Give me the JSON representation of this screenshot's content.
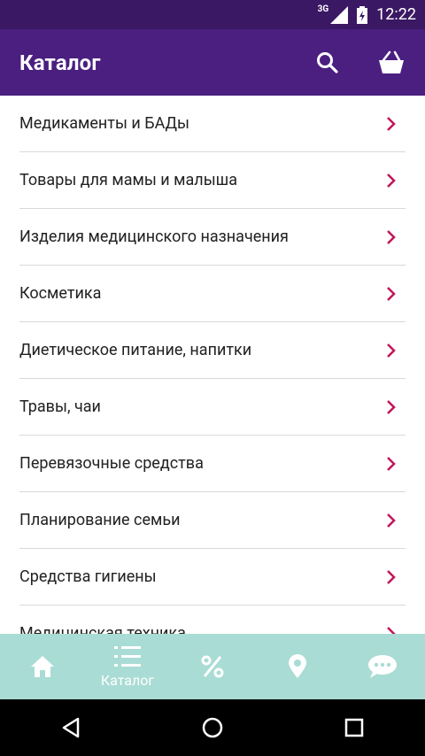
{
  "status_bar": {
    "network": "3G",
    "time": "12:22"
  },
  "app_bar": {
    "title": "Каталог",
    "search_icon": "search-icon",
    "cart_icon": "basket-icon"
  },
  "catalog": {
    "items": [
      {
        "label": "Медикаменты и БАДы"
      },
      {
        "label": "Товары для мамы и малыша"
      },
      {
        "label": "Изделия медицинского назначения"
      },
      {
        "label": "Косметика"
      },
      {
        "label": "Диетическое питание, напитки"
      },
      {
        "label": "Травы, чаи"
      },
      {
        "label": "Перевязочные средства"
      },
      {
        "label": "Планирование семьи"
      },
      {
        "label": "Средства гигиены"
      },
      {
        "label": "Медицинская техника"
      }
    ]
  },
  "bottom_nav": {
    "items": [
      {
        "icon": "home-icon",
        "label": ""
      },
      {
        "icon": "list-icon",
        "label": "Каталог"
      },
      {
        "icon": "percent-icon",
        "label": ""
      },
      {
        "icon": "location-pin-icon",
        "label": ""
      },
      {
        "icon": "chat-icon",
        "label": ""
      }
    ]
  },
  "colors": {
    "status_bar": "#3a1863",
    "app_bar": "#4a1f80",
    "accent_chevron": "#c2185b",
    "bottom_nav": "#a9dcd4",
    "bottom_nav_icon": "#ffffff",
    "divider": "#d9d9d9"
  }
}
